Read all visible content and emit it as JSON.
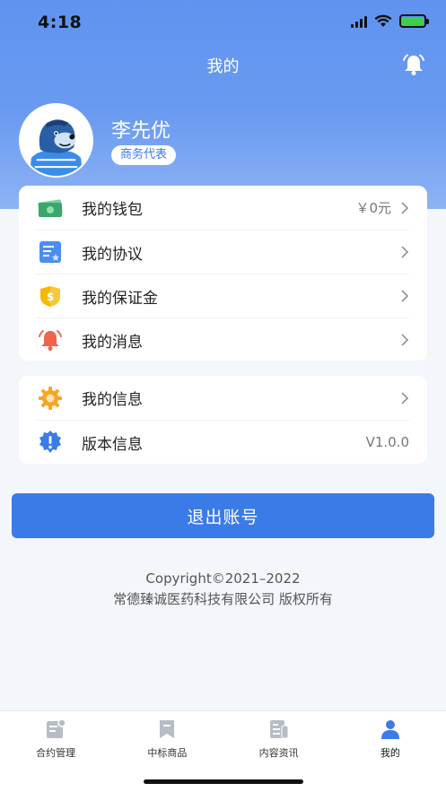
{
  "status_bar": {
    "time": "4:18",
    "battery_charging": true
  },
  "header": {
    "title": "我的"
  },
  "profile": {
    "name": "李先优",
    "role": "商务代表"
  },
  "menu_group_1": [
    {
      "label": "我的钱包",
      "value": "￥0元",
      "icon": "wallet-icon",
      "icon_color": "#3aa66b"
    },
    {
      "label": "我的协议",
      "value": "",
      "icon": "agreement-icon",
      "icon_color": "#4a8ff0"
    },
    {
      "label": "我的保证金",
      "value": "",
      "icon": "deposit-icon",
      "icon_color": "#f5b800"
    },
    {
      "label": "我的消息",
      "value": "",
      "icon": "bell-icon",
      "icon_color": "#f0644c"
    }
  ],
  "menu_group_2": [
    {
      "label": "我的信息",
      "value": "",
      "icon": "settings-icon",
      "icon_color": "#f5a623"
    },
    {
      "label": "版本信息",
      "value": "V1.0.0",
      "icon": "info-icon",
      "icon_color": "#3b7be8"
    }
  ],
  "logout": {
    "label": "退出账号"
  },
  "footer": {
    "line1": "Copyright©2021–2022",
    "line2": "常德臻诚医药科技有限公司  版权所有"
  },
  "tabbar": [
    {
      "label": "合约管理",
      "icon": "contract-icon",
      "active": false
    },
    {
      "label": "中标商品",
      "icon": "bookmark-icon",
      "active": false
    },
    {
      "label": "内容资讯",
      "icon": "news-icon",
      "active": false
    },
    {
      "label": "我的",
      "icon": "user-icon",
      "active": true
    }
  ],
  "colors": {
    "primary": "#3b7be8",
    "header_gradient_top": "#5f93ef",
    "inactive_tab_icon": "#b8bcc4"
  }
}
